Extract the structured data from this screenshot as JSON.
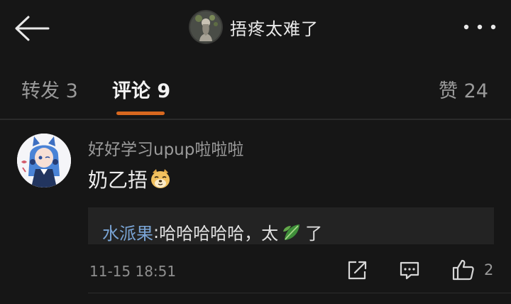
{
  "header": {
    "title": "捂疼太难了",
    "back_icon": "back-arrow-icon",
    "more_icon": "more-dots-icon"
  },
  "tabs": [
    {
      "label": "转发 3",
      "active": false
    },
    {
      "label": "评论 9",
      "active": true
    },
    {
      "label": "赞 24",
      "active": false
    }
  ],
  "colors": {
    "accent": "#d8681f",
    "background": "#161616",
    "reply_user": "#7aa5d6"
  },
  "comment": {
    "username": "好好学习upup啦啦啦",
    "text": "奶乙捂",
    "emoji": "doge-emoji",
    "reply": {
      "user": "水派果",
      "separator": ": ",
      "text_before": "哈哈哈哈哈，太",
      "leaf_emoji": "leaf-emoji",
      "text_after": " 了"
    },
    "time": "11-15 18:51",
    "like_count": "2"
  }
}
